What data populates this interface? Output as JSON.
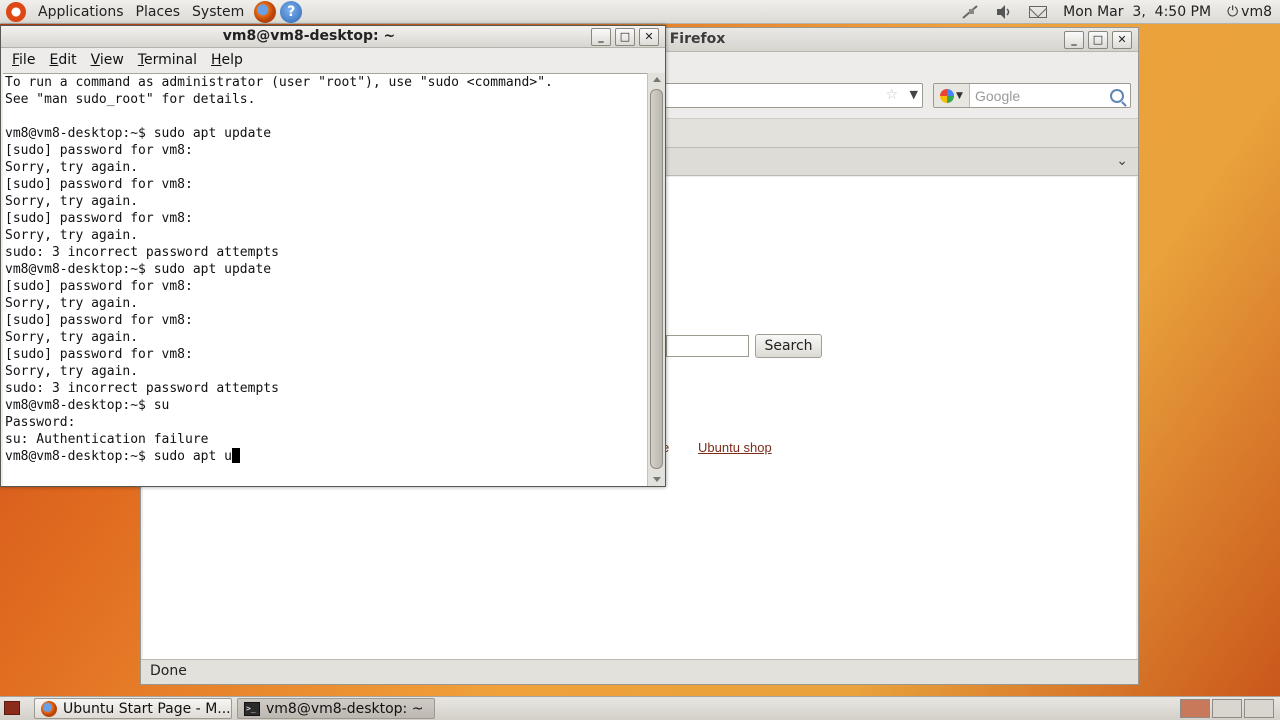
{
  "top_panel": {
    "menus": [
      "Applications",
      "Places",
      "System"
    ],
    "clock": "Mon Mar  3,  4:50 PM",
    "user": "vm8"
  },
  "firefox": {
    "title_visible": "illa Firefox",
    "search_placeholder": "Google",
    "search_button": "Search",
    "link_fragment": "e",
    "link_shop": "Ubuntu shop",
    "status": "Done"
  },
  "terminal": {
    "title": "vm8@vm8-desktop: ~",
    "menu": [
      "File",
      "Edit",
      "View",
      "Terminal",
      "Help"
    ],
    "lines": [
      "To run a command as administrator (user \"root\"), use \"sudo <command>\".",
      "See \"man sudo_root\" for details.",
      "",
      "vm8@vm8-desktop:~$ sudo apt update",
      "[sudo] password for vm8:",
      "Sorry, try again.",
      "[sudo] password for vm8:",
      "Sorry, try again.",
      "[sudo] password for vm8:",
      "Sorry, try again.",
      "sudo: 3 incorrect password attempts",
      "vm8@vm8-desktop:~$ sudo apt update",
      "[sudo] password for vm8:",
      "Sorry, try again.",
      "[sudo] password for vm8:",
      "Sorry, try again.",
      "[sudo] password for vm8:",
      "Sorry, try again.",
      "sudo: 3 incorrect password attempts",
      "vm8@vm8-desktop:~$ su",
      "Password:",
      "su: Authentication failure"
    ],
    "current_input": "vm8@vm8-desktop:~$ sudo apt u"
  },
  "taskbar": {
    "items": [
      "Ubuntu Start Page - M...",
      "vm8@vm8-desktop: ~"
    ]
  },
  "icons": {
    "ubuntu": "ubuntu-logo-icon",
    "firefox": "firefox-icon",
    "help": "help-icon",
    "network": "network-icon",
    "volume": "volume-icon",
    "mail": "mail-icon",
    "power": "power-icon"
  },
  "colors": {
    "ubuntu_orange": "#dd4814",
    "link": "#7b2d1c"
  }
}
